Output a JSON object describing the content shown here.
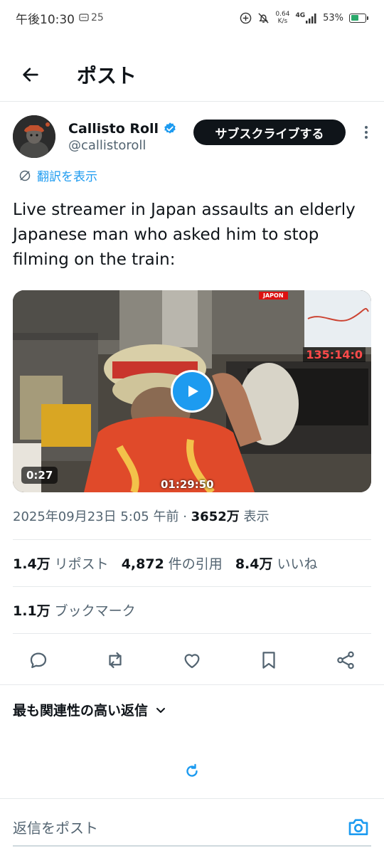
{
  "status_bar": {
    "time": "午後10:30",
    "notification_count": "25",
    "speed_value": "0.64",
    "speed_unit": "K/s",
    "network": "4G",
    "battery": "53%",
    "battery_level": 0.53
  },
  "header": {
    "title": "ポスト"
  },
  "author": {
    "name": "Callisto Roll",
    "handle": "@callistoroll",
    "subscribe_label": "サブスクライブする"
  },
  "translate_label": "翻訳を表示",
  "tweet": {
    "text": "Live streamer in Japan assaults an elderly Japanese man who asked him to stop filming on the train:"
  },
  "video": {
    "duration": "0:27",
    "overlay_time": "01:29:50",
    "overlay_counter": "135:14:0",
    "overlay_tag": "JAPON"
  },
  "meta": {
    "date": "2025年09月23日 5:05 午前 · ",
    "views": "3652万",
    "views_label": " 表示"
  },
  "stats": {
    "reposts": "1.4万",
    "reposts_label": "リポスト",
    "quotes": "4,872",
    "quotes_label": "件の引用",
    "likes": "8.4万",
    "likes_label": "いいね",
    "bookmarks": "1.1万",
    "bookmarks_label": "ブックマーク"
  },
  "replies": {
    "sort_label": "最も関連性の高い返信"
  },
  "reply_bar": {
    "placeholder": "返信をポスト"
  },
  "colors": {
    "accent": "#1d9bf0",
    "text": "#0f1419",
    "secondary": "#536471"
  }
}
